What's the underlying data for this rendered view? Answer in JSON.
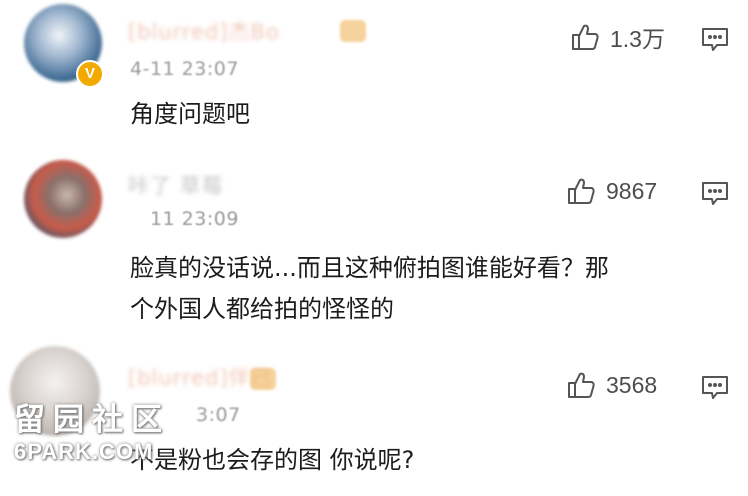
{
  "comments": [
    {
      "username": "[blurred]杰Bo",
      "timestamp": "4-11 23:07",
      "text": "角度问题吧",
      "like_count": "1.3万",
      "verified_badge": "V",
      "icons": {
        "like": "thumbs-up-icon",
        "reply": "comment-reply-icon"
      }
    },
    {
      "username": "咔了 草莓",
      "timestamp": "4-11 23:09",
      "text_line1": "脸真的没话说...而且这种俯拍图谁能好看？那",
      "text_line2": "个外国人都给拍的怪怪的",
      "like_count": "9867",
      "icons": {
        "like": "thumbs-up-icon",
        "reply": "comment-reply-icon"
      }
    },
    {
      "username": "[blurred]伴已",
      "timestamp": "3:07",
      "text": "不是粉也会存的图 你说呢?",
      "like_count": "3568",
      "icons": {
        "like": "thumbs-up-icon",
        "reply": "comment-reply-icon"
      }
    }
  ],
  "watermark": {
    "chinese": "留园社区",
    "english": "6PARK.COM"
  },
  "colors": {
    "text_primary": "#1c1c1c",
    "text_secondary": "#9a9a9a",
    "badge_gold": "#f2a900",
    "icon_gray": "#555555"
  }
}
